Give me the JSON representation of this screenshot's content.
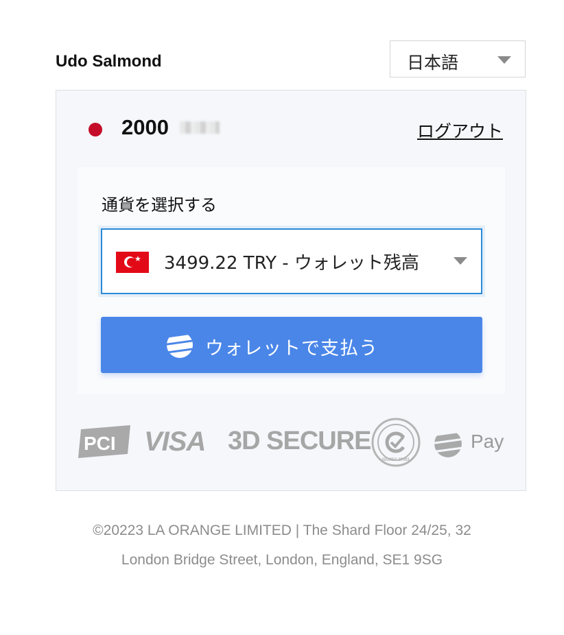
{
  "header": {
    "user_name": "Udo Salmond",
    "language_selected": "日本語"
  },
  "balance": {
    "amount": "2000",
    "logout_label": "ログアウト"
  },
  "currency_picker": {
    "label": "通貨を選択する",
    "selected_option": "3499.22 TRY - ウォレット残高",
    "flag": "turkey-flag"
  },
  "pay_button": {
    "label": "ウォレットで支払う",
    "icon": "wallet-pay-icon"
  },
  "badges": {
    "pci": "PCI",
    "visa": "VISA",
    "secure": "3D SECURE",
    "iso": "ISO/IEC 27001",
    "pay": "Pay"
  },
  "footer": {
    "line1": "©20223 LA ORANGE LIMITED | The Shard Floor 24/25, 32",
    "line2": "London Bridge Street, London, England, SE1 9SG"
  },
  "colors": {
    "accent": "#4a86e8",
    "focus_border": "#2b8ad6",
    "status_dot": "#c40e2a"
  }
}
